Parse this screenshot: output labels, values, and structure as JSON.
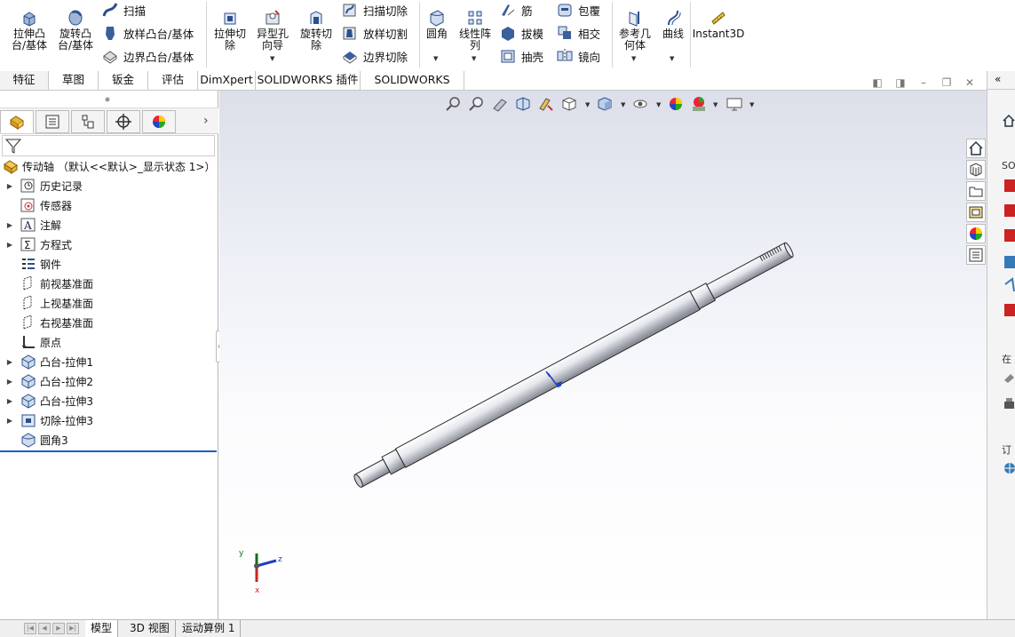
{
  "ribbon": {
    "extrude_boss": "拉伸凸\n台/基体",
    "revolve_boss": "旋转凸\n台/基体",
    "sweep": "扫描",
    "loft_boss": "放样凸台/基体",
    "boundary_boss": "边界凸台/基体",
    "extrude_cut": "拉伸切\n除",
    "hole_wizard": "异型孔\n向导",
    "revolve_cut": "旋转切\n除",
    "swept_cut": "扫描切除",
    "lofted_cut": "放样切割",
    "boundary_cut": "边界切除",
    "fillet": "圆角",
    "linear_pattern": "线性阵\n列",
    "rib": "筋",
    "draft": "拔模",
    "shell": "抽壳",
    "wrap": "包覆",
    "intersect": "相交",
    "mirror": "镜向",
    "ref_geometry": "参考几\n何体",
    "curves": "曲线",
    "instant3d": "Instant3D"
  },
  "tabs": [
    "特征",
    "草图",
    "钣金",
    "评估",
    "DimXpert",
    "SOLIDWORKS 插件",
    "SOLIDWORKS MBD"
  ],
  "tree": {
    "root": "传动轴 （默认<<默认>_显示状态 1>）",
    "items": [
      "历史记录",
      "传感器",
      "注解",
      "方程式",
      "钢件",
      "前视基准面",
      "上视基准面",
      "右视基准面",
      "原点",
      "凸台-拉伸1",
      "凸台-拉伸2",
      "凸台-拉伸3",
      "切除-拉伸3",
      "圆角3"
    ]
  },
  "bottom_tabs": [
    "模型",
    "3D 视图",
    "运动算例 1"
  ],
  "triad": {
    "x": "x",
    "y": "y",
    "z": "z"
  },
  "right_panel": {
    "label1": "SO",
    "label2": "在",
    "label3": "订"
  },
  "colors": {
    "accent": "#1f5fbf",
    "part_icon": "#e8b53a"
  }
}
